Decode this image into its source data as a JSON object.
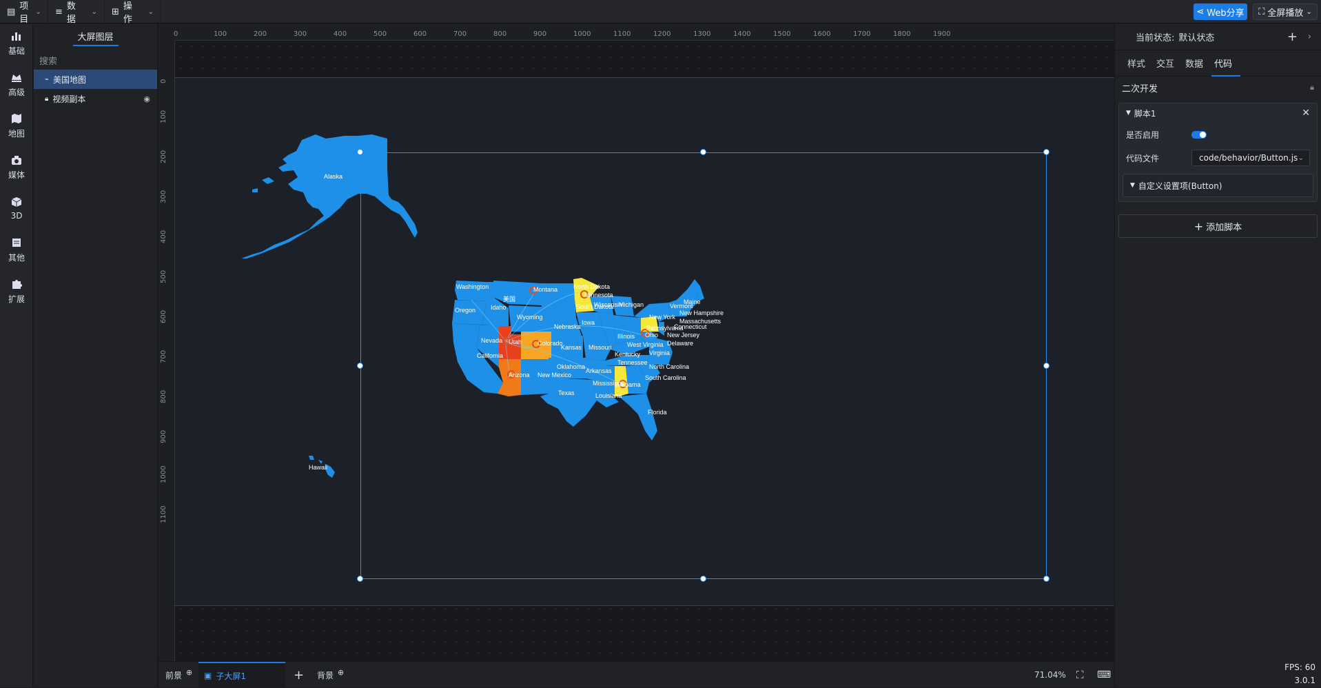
{
  "topbar": {
    "menus": [
      {
        "label": "项目",
        "icon": "file-icon"
      },
      {
        "label": "数据",
        "icon": "database-icon"
      },
      {
        "label": "操作",
        "icon": "grid-icon"
      }
    ],
    "share_label": "Web分享",
    "fullscreen_label": "全屏播放"
  },
  "left_icons": [
    {
      "label": "基础",
      "icon": "bar-chart-icon"
    },
    {
      "label": "高级",
      "icon": "crown-icon"
    },
    {
      "label": "地图",
      "icon": "map-icon"
    },
    {
      "label": "媒体",
      "icon": "media-icon"
    },
    {
      "label": "3D",
      "icon": "cube-icon"
    },
    {
      "label": "其他",
      "icon": "stack-icon"
    },
    {
      "label": "扩展",
      "icon": "puzzle-icon"
    }
  ],
  "layers": {
    "title": "大屏图层",
    "search_placeholder": "搜索",
    "items": [
      {
        "label": "美国地图",
        "active": true
      },
      {
        "label": "视频副本",
        "active": false
      }
    ]
  },
  "ruler": {
    "top": [
      "0",
      "100",
      "200",
      "300",
      "400",
      "500",
      "600",
      "700",
      "800",
      "900",
      "1000",
      "1100",
      "1200",
      "1300",
      "1400",
      "1500",
      "1600",
      "1700",
      "1800",
      "1900"
    ],
    "left": [
      "0",
      "100",
      "200",
      "300",
      "400",
      "500",
      "600",
      "700",
      "800",
      "900",
      "1000",
      "1100"
    ]
  },
  "map": {
    "labels": [
      "Alaska",
      "Hawaii",
      "Washington",
      "Montana",
      "North Dakota",
      "Minnesota",
      "Oregon",
      "Idaho",
      "South Dakota",
      "Wisconsin",
      "Michigan",
      "Maine",
      "Vermont",
      "New Hampshire",
      "Massachusetts",
      "Connecticut",
      "New York",
      "Wyoming",
      "Iowa",
      "Nebraska",
      "Pennsylvania",
      "New Jersey",
      "Nevada",
      "Utah",
      "Colorado",
      "Illinois",
      "Ohio",
      "Delaware",
      "California",
      "Kansas",
      "Missouri",
      "West Virginia",
      "Virginia",
      "Kentucky",
      "Oklahoma",
      "Tennessee",
      "North Carolina",
      "Arkansas",
      "Arizona",
      "New Mexico",
      "South Carolina",
      "Mississippi",
      "Alabama",
      "Texas",
      "Louisiana",
      "Florida",
      "美国"
    ],
    "colors": {
      "base": "#1e90e8",
      "yellow": "#f5e83a",
      "orange": "#f6a623",
      "red": "#e8401c",
      "dark_orange": "#f07a18"
    }
  },
  "bottombar": {
    "front_label": "前景",
    "sub_label": "子大屏1",
    "bg_label": "背景",
    "zoom": "71.04%"
  },
  "right": {
    "state_label": "当前状态:",
    "state_value": "默认状态",
    "tabs": [
      "样式",
      "交互",
      "数据",
      "代码"
    ],
    "active_tab": "代码",
    "section_title": "二次开发",
    "script": {
      "title": "脚本1",
      "enable_label": "是否启用",
      "file_label": "代码文件",
      "file_value": "code/behavior/Button.js",
      "custom_label": "自定义设置项(Button)"
    },
    "add_script_label": "添加脚本",
    "fps": "FPS: 60",
    "version": "3.0.1"
  }
}
